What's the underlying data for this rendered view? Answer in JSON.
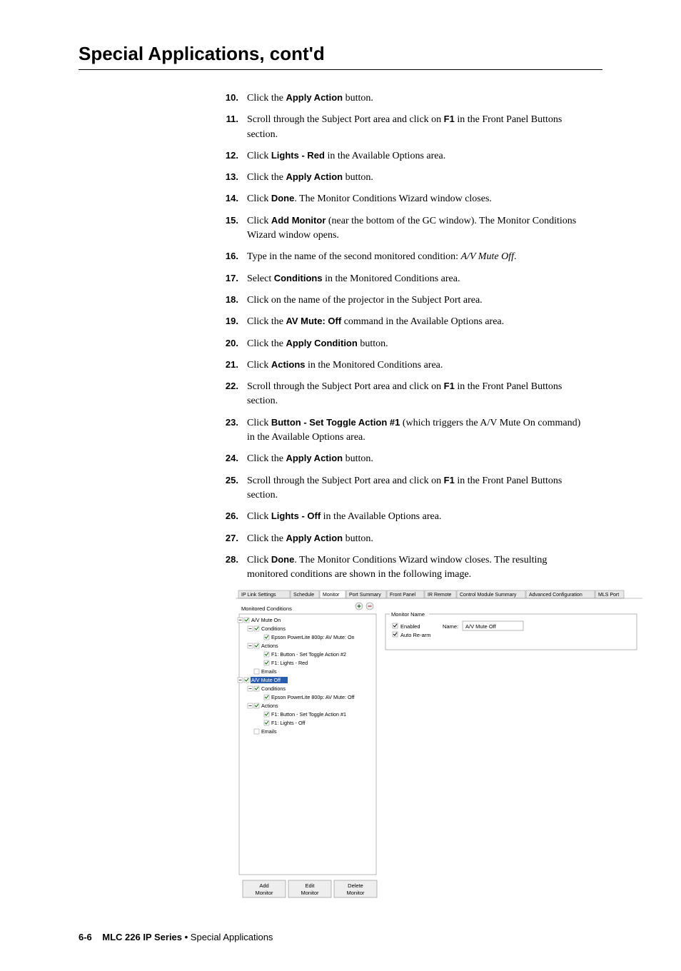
{
  "page_title": "Special Applications, cont'd",
  "steps": [
    {
      "n": "10.",
      "parts": [
        {
          "t": "Click the "
        },
        {
          "t": "Apply Action",
          "b": true
        },
        {
          "t": " button."
        }
      ]
    },
    {
      "n": "11.",
      "parts": [
        {
          "t": "Scroll through the Subject Port area and click on "
        },
        {
          "t": "F1",
          "b": true
        },
        {
          "t": " in the Front Panel Buttons section."
        }
      ]
    },
    {
      "n": "12.",
      "parts": [
        {
          "t": "Click "
        },
        {
          "t": "Lights - Red",
          "b": true
        },
        {
          "t": " in the Available Options area."
        }
      ]
    },
    {
      "n": "13.",
      "parts": [
        {
          "t": "Click the "
        },
        {
          "t": "Apply Action",
          "b": true
        },
        {
          "t": " button."
        }
      ]
    },
    {
      "n": "14.",
      "parts": [
        {
          "t": "Click "
        },
        {
          "t": "Done",
          "b": true
        },
        {
          "t": ".  The Monitor Conditions Wizard window closes."
        }
      ]
    },
    {
      "n": "15.",
      "parts": [
        {
          "t": "Click "
        },
        {
          "t": "Add Monitor",
          "b": true
        },
        {
          "t": " (near the bottom of the GC window).  The Monitor Conditions Wizard window opens."
        }
      ]
    },
    {
      "n": "16.",
      "parts": [
        {
          "t": "Type in the name of the second monitored condition: "
        },
        {
          "t": "A/V Mute Off",
          "i": true
        },
        {
          "t": "."
        }
      ]
    },
    {
      "n": "17.",
      "parts": [
        {
          "t": "Select "
        },
        {
          "t": "Conditions",
          "b": true
        },
        {
          "t": " in the Monitored Conditions area."
        }
      ]
    },
    {
      "n": "18.",
      "parts": [
        {
          "t": "Click on the name of the projector in the Subject Port area."
        }
      ]
    },
    {
      "n": "19.",
      "parts": [
        {
          "t": "Click the "
        },
        {
          "t": "AV Mute: Off",
          "b": true
        },
        {
          "t": " command in the Available Options area."
        }
      ]
    },
    {
      "n": "20.",
      "parts": [
        {
          "t": "Click the "
        },
        {
          "t": "Apply Condition",
          "b": true
        },
        {
          "t": " button."
        }
      ]
    },
    {
      "n": "21.",
      "parts": [
        {
          "t": "Click "
        },
        {
          "t": "Actions",
          "b": true
        },
        {
          "t": " in the Monitored Conditions area."
        }
      ]
    },
    {
      "n": "22.",
      "parts": [
        {
          "t": "Scroll through the Subject Port area and click on "
        },
        {
          "t": "F1",
          "b": true
        },
        {
          "t": " in the Front Panel Buttons section."
        }
      ]
    },
    {
      "n": "23.",
      "parts": [
        {
          "t": "Click "
        },
        {
          "t": "Button - Set Toggle Action #1",
          "b": true
        },
        {
          "t": " (which triggers the A/V Mute On command) in the Available Options area."
        }
      ]
    },
    {
      "n": "24.",
      "parts": [
        {
          "t": "Click the "
        },
        {
          "t": "Apply Action",
          "b": true
        },
        {
          "t": " button."
        }
      ]
    },
    {
      "n": "25.",
      "parts": [
        {
          "t": "Scroll through the Subject Port area and click on "
        },
        {
          "t": "F1",
          "b": true
        },
        {
          "t": " in the Front Panel Buttons section."
        }
      ]
    },
    {
      "n": "26.",
      "parts": [
        {
          "t": "Click "
        },
        {
          "t": "Lights - Off",
          "b": true
        },
        {
          "t": " in the Available Options area."
        }
      ]
    },
    {
      "n": "27.",
      "parts": [
        {
          "t": "Click the "
        },
        {
          "t": "Apply Action",
          "b": true
        },
        {
          "t": " button."
        }
      ]
    },
    {
      "n": "28.",
      "parts": [
        {
          "t": "Click "
        },
        {
          "t": "Done",
          "b": true
        },
        {
          "t": ".  The Monitor Conditions Wizard window closes.  The resulting monitored conditions are shown in the following image."
        }
      ]
    }
  ],
  "figure": {
    "tabs": [
      "IP Link Settings",
      "Schedule",
      "Monitor",
      "Port Summary",
      "Front Panel",
      "IR Remote",
      "Control Module Summary",
      "Advanced Configuration",
      "MLS Port"
    ],
    "active_tab": "Monitor",
    "panel_title": "Monitored Conditions",
    "tree": [
      {
        "level": 0,
        "check": true,
        "label": "A/V Mute On",
        "expand": "-"
      },
      {
        "level": 1,
        "check": true,
        "label": "Conditions",
        "expand": "-"
      },
      {
        "level": 2,
        "check": true,
        "label": "Epson PowerLite 800p: AV Mute: On"
      },
      {
        "level": 1,
        "check": true,
        "label": "Actions",
        "expand": "-"
      },
      {
        "level": 2,
        "check": true,
        "label": "F1: Button - Set Toggle Action #2"
      },
      {
        "level": 2,
        "check": true,
        "label": "F1: Lights - Red"
      },
      {
        "level": 1,
        "check": false,
        "label": "Emails"
      },
      {
        "level": 0,
        "check": true,
        "label": "A/V Mute Off",
        "selected": true,
        "expand": "-"
      },
      {
        "level": 1,
        "check": true,
        "label": "Conditions",
        "expand": "-"
      },
      {
        "level": 2,
        "check": true,
        "label": "Epson PowerLite 800p: AV Mute: Off"
      },
      {
        "level": 1,
        "check": true,
        "label": "Actions",
        "expand": "-"
      },
      {
        "level": 2,
        "check": true,
        "label": "F1: Button - Set Toggle Action #1"
      },
      {
        "level": 2,
        "check": true,
        "label": "F1: Lights - Off"
      },
      {
        "level": 1,
        "check": false,
        "label": "Emails"
      }
    ],
    "buttons": [
      "Add\nMonitor",
      "Edit\nMonitor",
      "Delete\nMonitor"
    ],
    "monitor_name_group": "Monitor Name",
    "enabled_label": "Enabled",
    "autorearm_label": "Auto Re-arm",
    "name_label": "Name:",
    "name_value": "A/V Mute Off"
  },
  "footer": {
    "page": "6-6",
    "product": "MLC 226 IP Series",
    "sep": " • ",
    "section": "Special Applications"
  }
}
